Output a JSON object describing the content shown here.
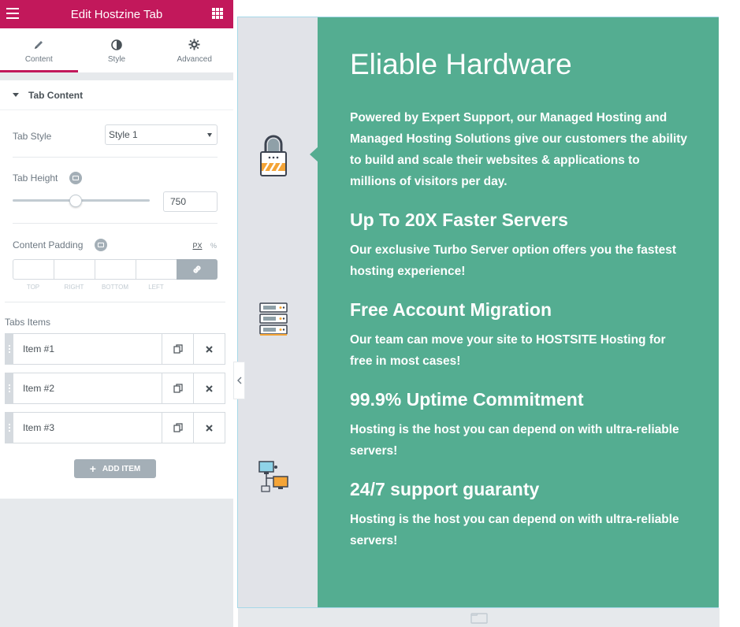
{
  "panel": {
    "title": "Edit Hostzine Tab",
    "tabs": [
      {
        "label": "Content",
        "icon": "pencil-icon"
      },
      {
        "label": "Style",
        "icon": "contrast-icon"
      },
      {
        "label": "Advanced",
        "icon": "gear-icon"
      }
    ],
    "section_title": "Tab Content",
    "tab_style": {
      "label": "Tab Style",
      "value": "Style 1"
    },
    "tab_height": {
      "label": "Tab Height",
      "value": "750"
    },
    "content_padding": {
      "label": "Content Padding",
      "unit_px": "PX",
      "unit_pct": "%",
      "dims": [
        "TOP",
        "RIGHT",
        "BOTTOM",
        "LEFT"
      ]
    },
    "tabs_items": {
      "label": "Tabs Items",
      "items": [
        "Item #1",
        "Item #2",
        "Item #3"
      ],
      "add_label": "ADD ITEM"
    }
  },
  "preview": {
    "heading": "Eliable Hardware",
    "intro": "Powered by Expert Support, our Managed Hosting and Managed Hosting Solutions give our customers the ability to build and scale their websites & applications to millions of visitors per day.",
    "features": [
      {
        "title": "Up To 20X Faster Servers",
        "text": "Our exclusive Turbo Server option offers you the fastest hosting experience!"
      },
      {
        "title": "Free Account Migration",
        "text": "Our team can move your site to HOSTSITE Hosting for free in most cases!"
      },
      {
        "title": "99.9% Uptime Commitment",
        "text": "Hosting is the host you can depend on with ultra-reliable servers!"
      },
      {
        "title": "24/7 support guaranty",
        "text": "Hosting is the host you can depend on with ultra-reliable servers!"
      }
    ],
    "tab_icons": [
      "padlock-icon",
      "server-rack-icon",
      "network-computers-icon"
    ]
  },
  "colors": {
    "brand": "#c2185b",
    "tab_green": "#54ad91",
    "icon_column": "#e1e3e8"
  }
}
